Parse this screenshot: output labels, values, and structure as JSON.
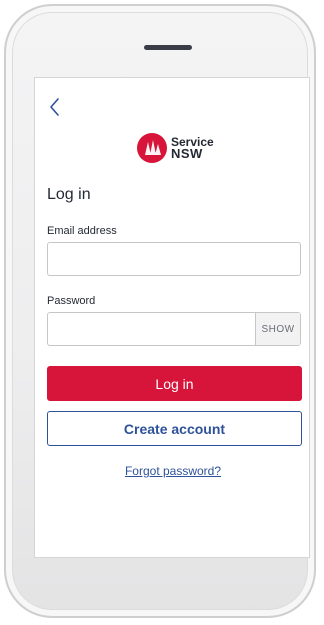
{
  "app": {
    "brand_line1": "Service",
    "brand_line2": "NSW",
    "brand_color": "#d7153a",
    "link_color": "#2e5299"
  },
  "header": {
    "back_icon": "chevron-left-icon"
  },
  "login": {
    "title": "Log in",
    "email_label": "Email address",
    "email_value": "",
    "password_label": "Password",
    "password_value": "",
    "show_label": "SHOW",
    "login_button": "Log in",
    "create_account_button": "Create account",
    "forgot_link": "Forgot password?"
  }
}
